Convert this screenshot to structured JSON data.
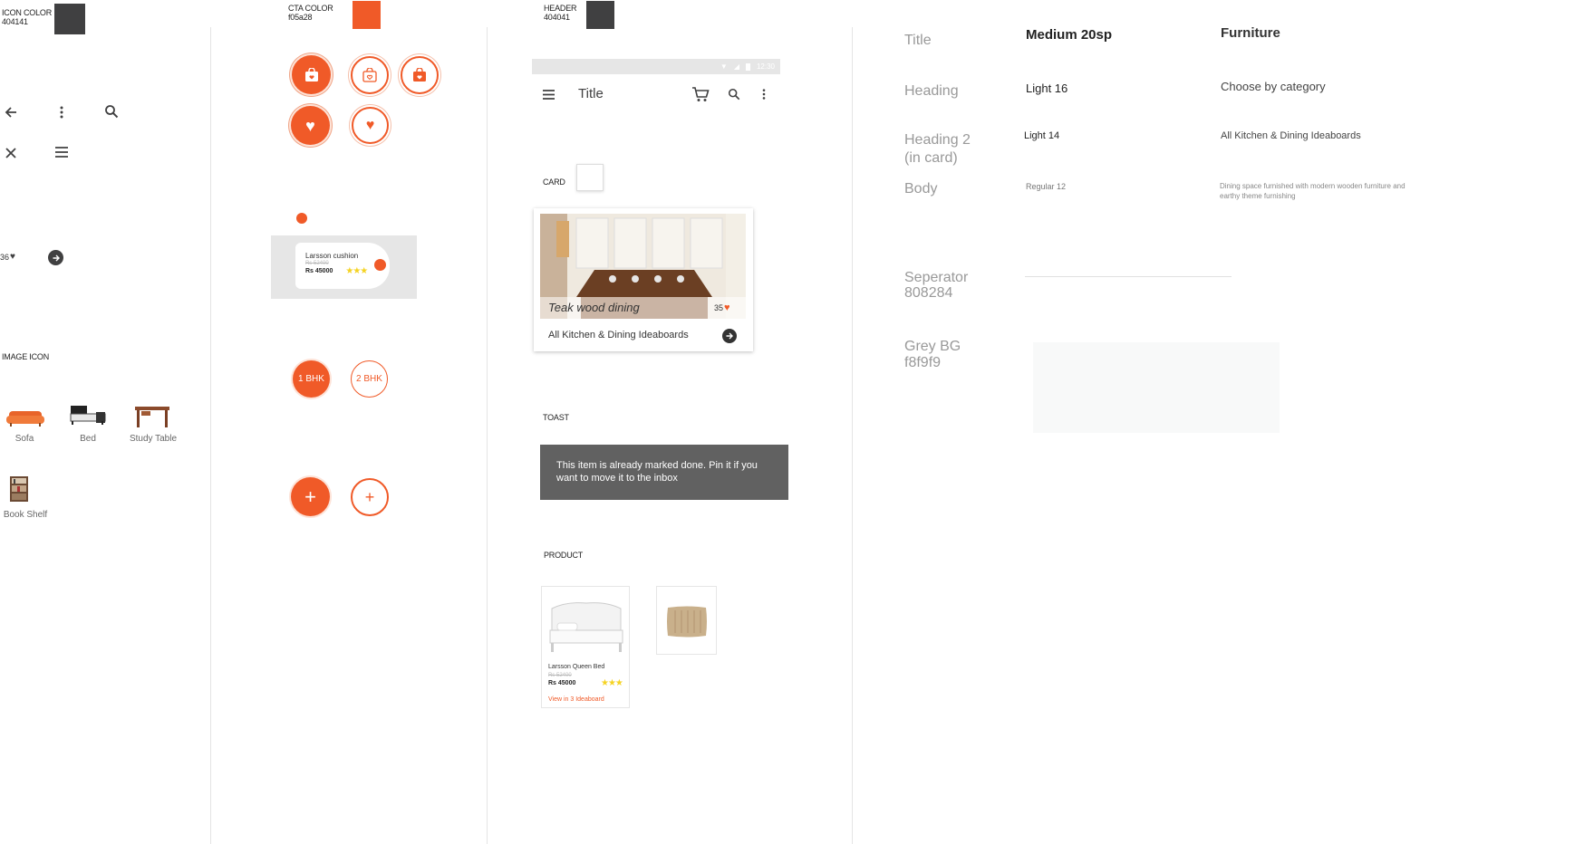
{
  "colors": {
    "icon": "#404041",
    "cta": "#f05a28",
    "header": "#404041",
    "separator": "#808284",
    "grey_bg": "#f8f9f9",
    "star": "#f5d323"
  },
  "col1": {
    "icon_color_label": "ICON COLOR",
    "icon_color_hex": "404141",
    "icons": [
      "arrow-back-icon",
      "more-vert-icon",
      "search-icon",
      "close-icon",
      "menu-icon"
    ],
    "likes_count": "36",
    "image_icon_label": "IMAGE ICON",
    "categories": [
      {
        "name": "sofa-icon",
        "label": "Sofa"
      },
      {
        "name": "bed-icon",
        "label": "Bed"
      },
      {
        "name": "study-table-icon",
        "label": "Study Table"
      },
      {
        "name": "book-shelf-icon",
        "label": "Book Shelf"
      }
    ]
  },
  "col2": {
    "cta_color_label": "CTA COLOR",
    "cta_color_hex": "f05a28",
    "toast": {
      "name": "Larsson cushion",
      "old_price": "Rs 52400",
      "price": "Rs 45000",
      "stars": "★★★"
    },
    "bhk": [
      "1 BHK",
      "2 BHK"
    ],
    "fab_symbol": "+"
  },
  "col3": {
    "header_label": "HEADER",
    "header_hex": "404041",
    "status_time": "12:30",
    "appbar_title": "Title",
    "card_label": "CARD",
    "card": {
      "image_title": "Teak wood dining",
      "likes": "35",
      "footer": "All Kitchen & Dining Ideaboards"
    },
    "toast_label": "TOAST",
    "toast_text": "This item is already marked done. Pin it if you want to move it to the inbox",
    "product_label": "PRODUCT",
    "product": {
      "name": "Larsson Queen Bed",
      "old_price": "Rs 52400",
      "price": "Rs 45000",
      "stars": "★★★",
      "view_link": "View in 3 Ideaboard"
    }
  },
  "typography": [
    {
      "label": "Title",
      "spec": "Medium 20sp",
      "example": "Furniture"
    },
    {
      "label": "Heading",
      "spec": "Light 16",
      "example": "Choose by category"
    },
    {
      "label": "Heading 2\n(in card)",
      "spec": "Light 14",
      "example": "All Kitchen & Dining Ideaboards"
    },
    {
      "label": "Body",
      "spec": "Regular 12",
      "example": "Dining space furnished with modern wooden furniture and earthy theme furnishing"
    }
  ],
  "separator_label": "Seperator\n808284",
  "grey_bg_label": "Grey BG\nf8f9f9"
}
